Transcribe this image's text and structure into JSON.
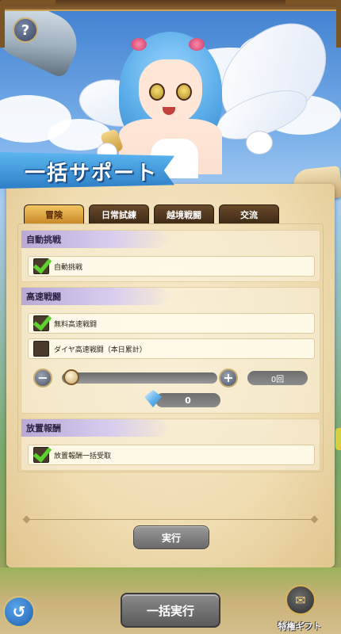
{
  "title": "一括サポート",
  "help_symbol": "?",
  "tabs": [
    {
      "label": "冒険",
      "active": true
    },
    {
      "label": "日常試練",
      "active": false
    },
    {
      "label": "越境戦闘",
      "active": false
    },
    {
      "label": "交流",
      "active": false
    }
  ],
  "sections": {
    "auto_battle": {
      "header": "自動挑戦",
      "options": [
        {
          "label": "自動挑戦",
          "checked": true
        }
      ]
    },
    "fast_battle": {
      "header": "高速戦闘",
      "options": [
        {
          "label": "無料高速戦闘",
          "checked": true
        },
        {
          "label": "ダイヤ高速戦闘（本日累計）",
          "checked": false
        }
      ],
      "slider": {
        "count": "0回",
        "minus": "−",
        "plus": "+"
      },
      "diamond_cost": "0"
    },
    "idle_reward": {
      "header": "放置報酬",
      "options": [
        {
          "label": "放置報酬一括受取",
          "checked": true
        }
      ]
    }
  },
  "execute_label": "実行",
  "bulk_execute_label": "一括実行",
  "back_symbol": "↺",
  "gift_label": "特権ギフト",
  "icons": [
    "help-icon",
    "sword-icon",
    "minus-icon",
    "plus-icon",
    "diamond-icon",
    "back-arrow-icon",
    "gift-scroll-icon"
  ]
}
